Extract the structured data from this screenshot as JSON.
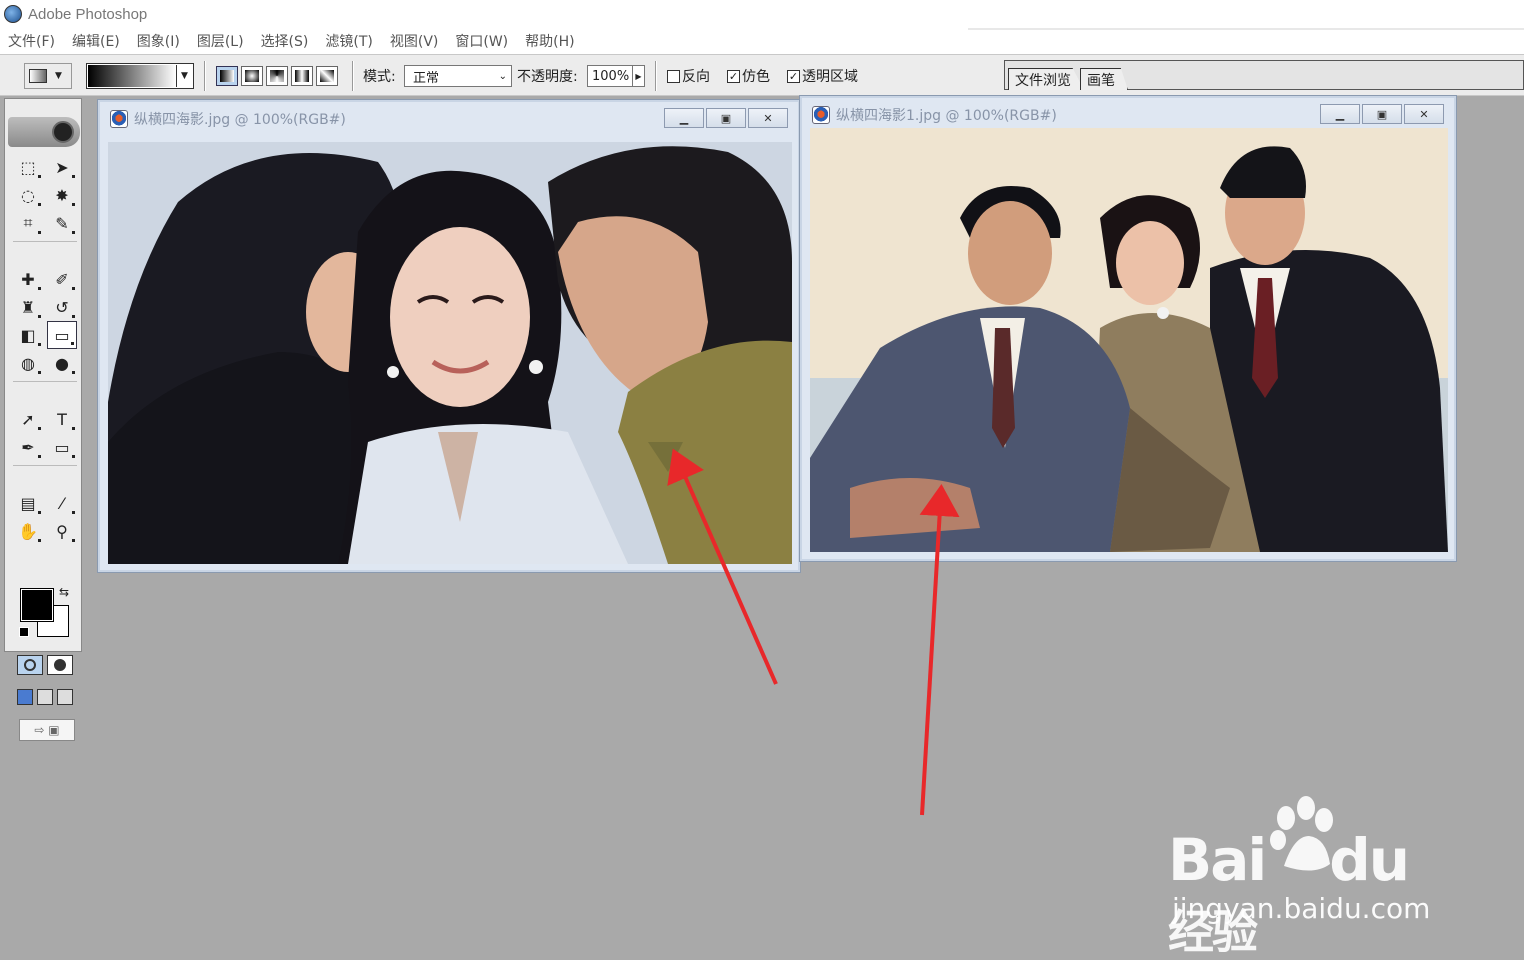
{
  "app": {
    "title": "Adobe Photoshop"
  },
  "menubar": {
    "items": [
      {
        "label": "文件(F)"
      },
      {
        "label": "编辑(E)"
      },
      {
        "label": "图象(I)"
      },
      {
        "label": "图层(L)"
      },
      {
        "label": "选择(S)"
      },
      {
        "label": "滤镜(T)"
      },
      {
        "label": "视图(V)"
      },
      {
        "label": "窗口(W)"
      },
      {
        "label": "帮助(H)"
      }
    ]
  },
  "options": {
    "mode_label": "模式:",
    "mode_value": "正常",
    "opacity_label": "不透明度:",
    "opacity_value": "100%",
    "reverse_label": "反向",
    "dither_label": "仿色",
    "transparency_label": "透明区域",
    "reverse_checked": false,
    "dither_checked": true,
    "transparency_checked": true
  },
  "palette_tabs": [
    {
      "label": "文件浏览"
    },
    {
      "label": "画笔"
    }
  ],
  "toolbox": {
    "tools": [
      {
        "name": "marquee-tool",
        "glyph": "⬚"
      },
      {
        "name": "move-tool",
        "glyph": "➤"
      },
      {
        "name": "lasso-tool",
        "glyph": "ᘏ"
      },
      {
        "name": "magic-wand-tool",
        "glyph": "✸"
      },
      {
        "name": "crop-tool",
        "glyph": "⌗"
      },
      {
        "name": "slice-tool",
        "glyph": "✎"
      },
      {
        "name": "healing-brush-tool",
        "glyph": "✚"
      },
      {
        "name": "brush-tool",
        "glyph": "✐"
      },
      {
        "name": "clone-stamp-tool",
        "glyph": "♜"
      },
      {
        "name": "history-brush-tool",
        "glyph": "↺"
      },
      {
        "name": "eraser-tool",
        "glyph": "◧"
      },
      {
        "name": "gradient-tool",
        "glyph": "▭"
      },
      {
        "name": "blur-tool",
        "glyph": "💧"
      },
      {
        "name": "dodge-tool",
        "glyph": "●"
      },
      {
        "name": "path-selection-tool",
        "glyph": "➚"
      },
      {
        "name": "type-tool",
        "glyph": "T"
      },
      {
        "name": "pen-tool",
        "glyph": "✒"
      },
      {
        "name": "shape-tool",
        "glyph": "▭"
      },
      {
        "name": "notes-tool",
        "glyph": "▤"
      },
      {
        "name": "eyedropper-tool",
        "glyph": "⁄"
      },
      {
        "name": "hand-tool",
        "glyph": "✋"
      },
      {
        "name": "zoom-tool",
        "glyph": "🔍"
      }
    ],
    "active_tool": "gradient-tool"
  },
  "documents": [
    {
      "title": "纵横四海影.jpg @ 100%(RGB#)"
    },
    {
      "title": "纵横四海影1.jpg @ 100%(RGB#)"
    }
  ],
  "watermark": {
    "logo": "Bai",
    "logo_du": "du",
    "logo_cn": "经验",
    "url": "jingyan.baidu.com"
  },
  "colors": {
    "workspace": "#a9a9a9",
    "annotation_arrow": "#e8282a",
    "foreground_swatch": "#000000",
    "background_swatch": "#ffffff"
  }
}
